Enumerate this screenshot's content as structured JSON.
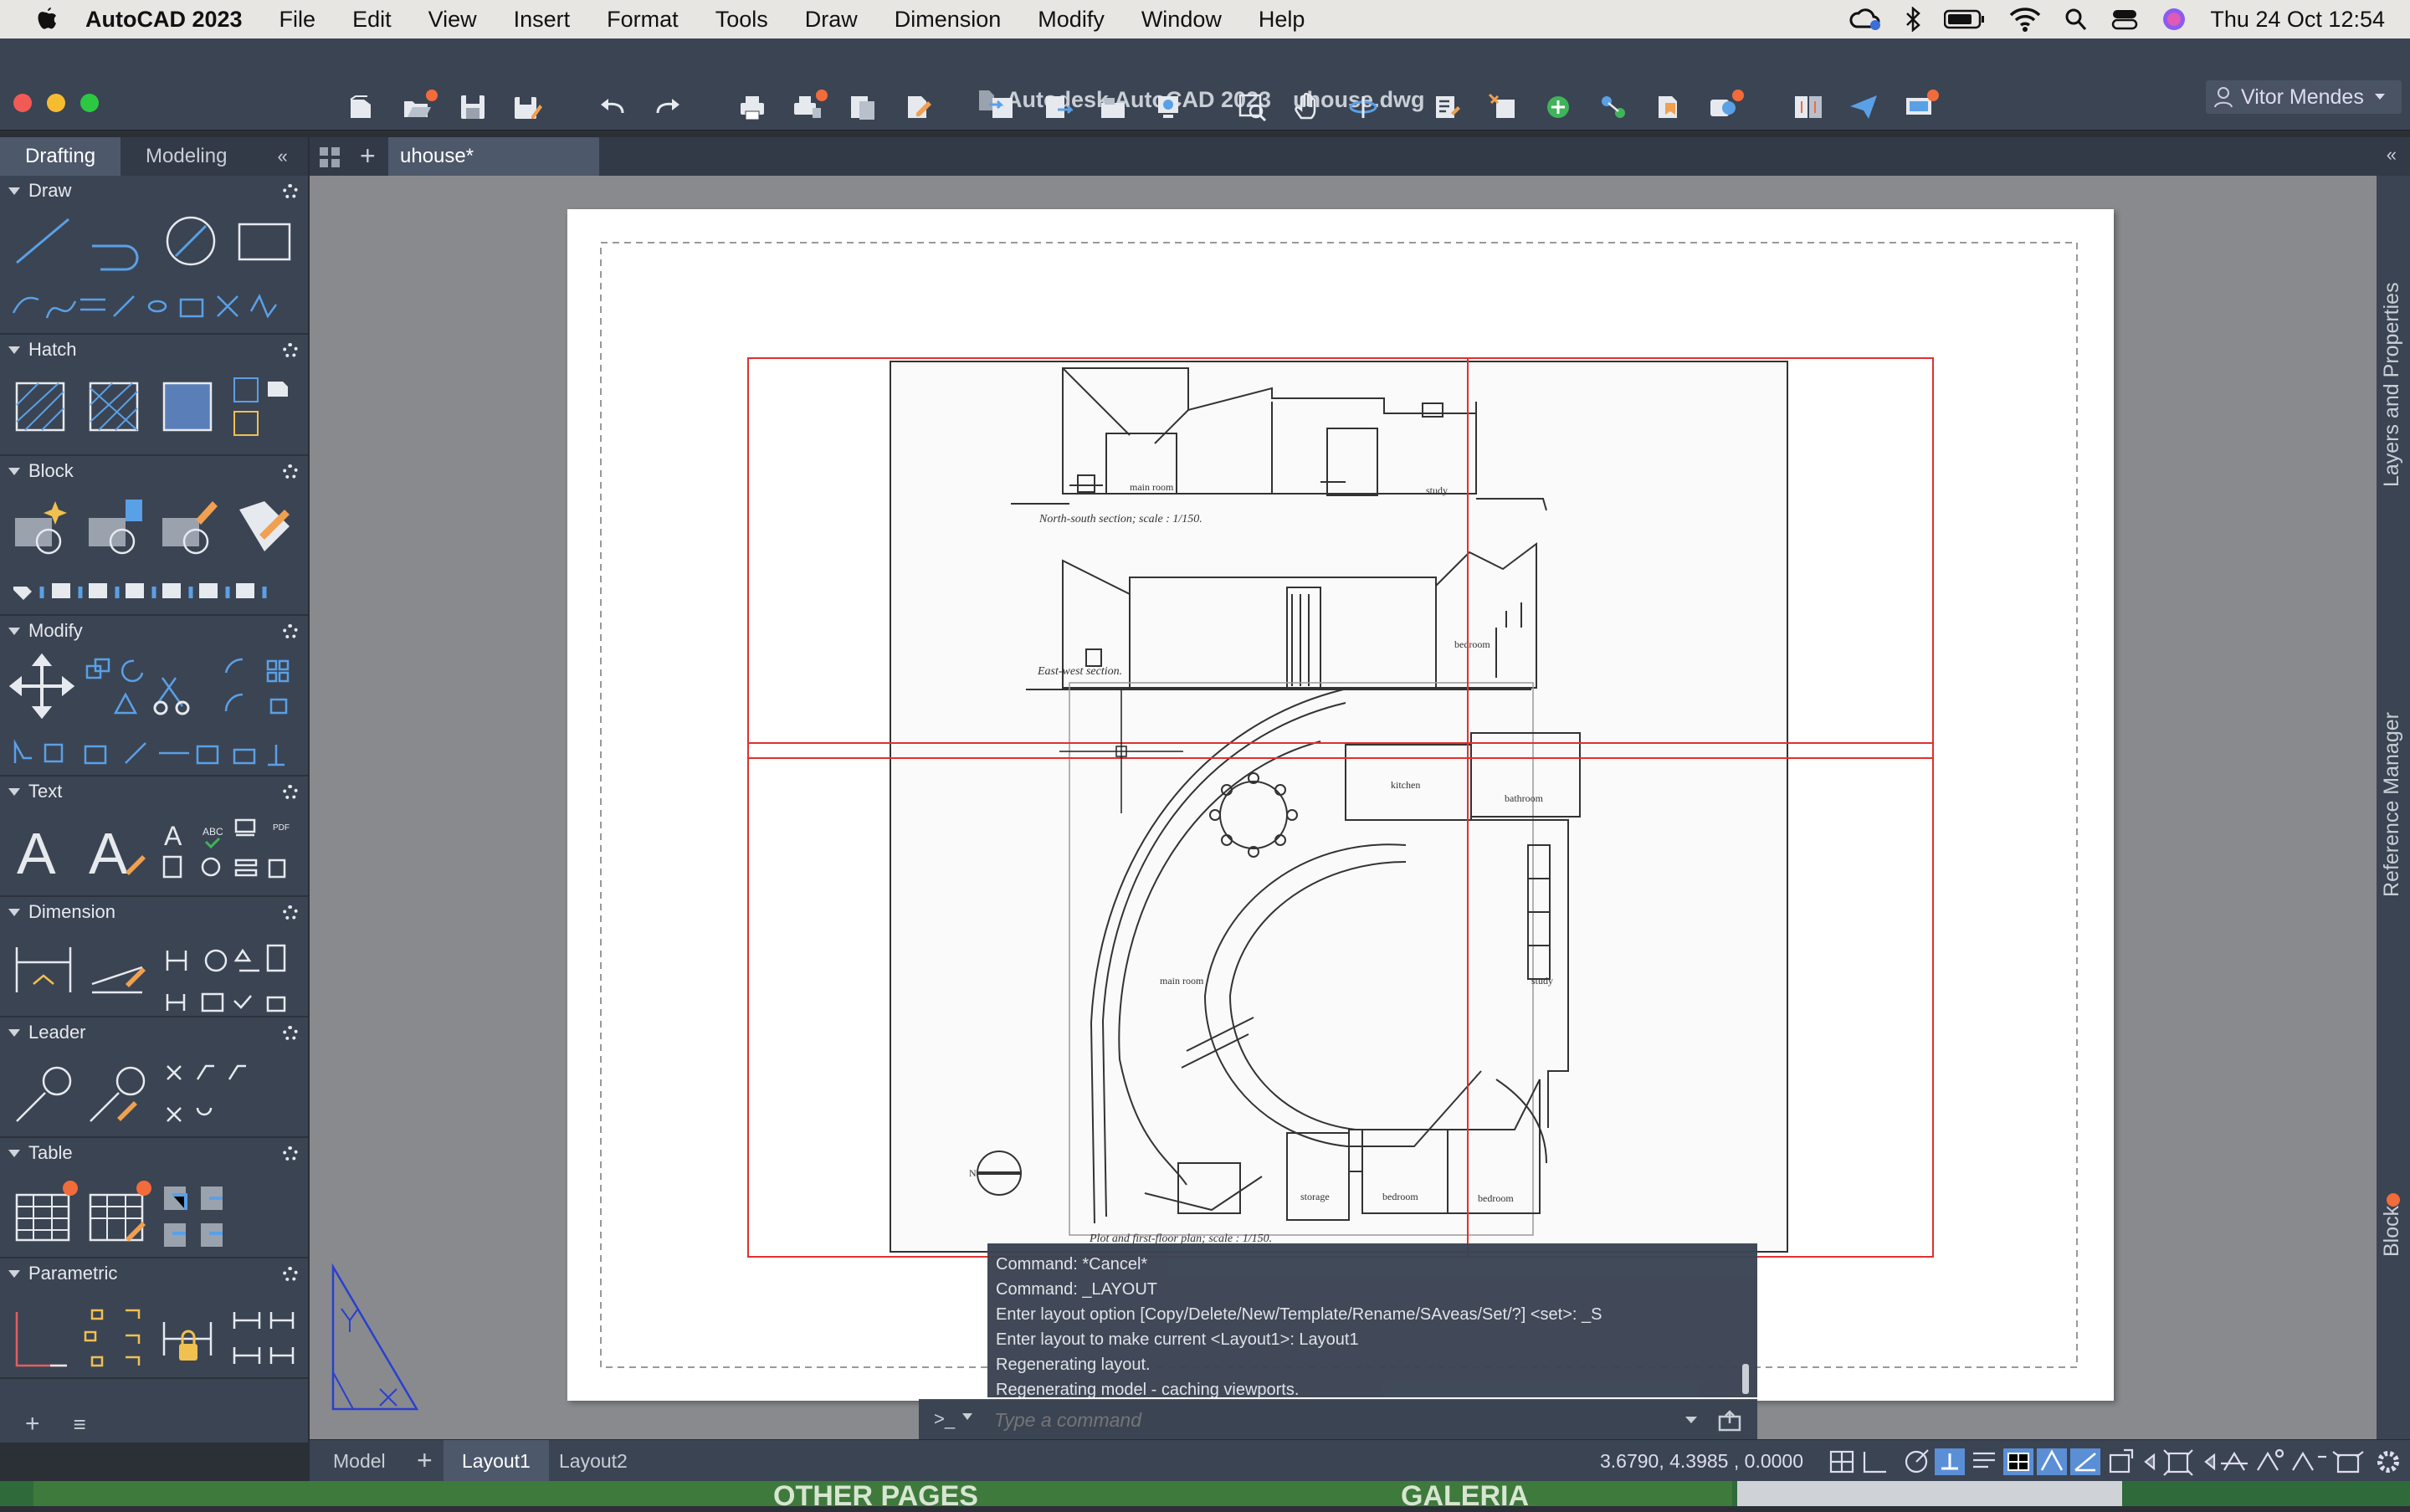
{
  "menubar": {
    "app_name": "AutoCAD 2023",
    "items": [
      "File",
      "Edit",
      "View",
      "Insert",
      "Format",
      "Tools",
      "Draw",
      "Dimension",
      "Modify",
      "Window",
      "Help"
    ],
    "datetime": "Thu 24 Oct  12:54"
  },
  "window": {
    "title": "Autodesk AutoCAD 2023",
    "filename": "uhouse.dwg",
    "user": "Vitor Mendes"
  },
  "palette": {
    "tabs": [
      "Drafting",
      "Modeling"
    ],
    "sections": [
      "Draw",
      "Hatch",
      "Block",
      "Modify",
      "Text",
      "Dimension",
      "Leader",
      "Table",
      "Parametric"
    ]
  },
  "doc_tab": "uhouse*",
  "right_panels": [
    "Layers and Properties",
    "Reference Manager",
    "Blocks"
  ],
  "drawing": {
    "labels": {
      "main_room_top": "main room",
      "study_top": "study",
      "ns_caption": "North-south section; scale : 1/150.",
      "bedroom_top": "bedroom",
      "ew_caption": "East-west section.",
      "kitchen": "kitchen",
      "bathroom": "bathroom",
      "main_room": "main room",
      "study": "study",
      "storage": "storage",
      "bedroom1": "bedroom",
      "bedroom2": "bedroom",
      "plan_caption": "Plot and first-floor plan; scale : 1/150.",
      "north": "N"
    }
  },
  "command": {
    "history": [
      "Command: *Cancel*",
      "Command: _LAYOUT",
      "Enter layout option [Copy/Delete/New/Template/Rename/SAveas/Set/?] <set>: _S",
      "Enter layout to make current <Layout1>: Layout1",
      "Regenerating layout.",
      "Regenerating model - caching viewports."
    ],
    "placeholder": "Type a command",
    "prompt": ">_"
  },
  "status": {
    "layouts": [
      "Model",
      "Layout1",
      "Layout2"
    ],
    "coords": "3.6790,  4.3985 , 0.0000"
  },
  "website": {
    "left": "OTHER PAGES",
    "right": "GALERIA"
  }
}
